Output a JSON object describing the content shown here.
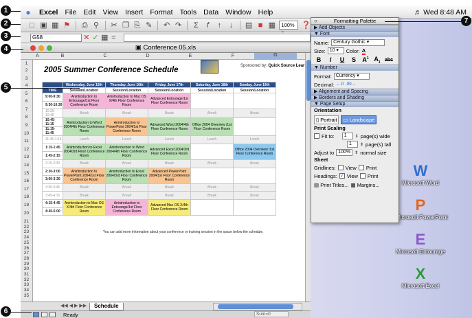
{
  "menubar": {
    "app": "Excel",
    "items": [
      "File",
      "Edit",
      "View",
      "Insert",
      "Format",
      "Tools",
      "Data",
      "Window",
      "Help"
    ],
    "clock": "Wed 8:48 AM"
  },
  "toolbar": {
    "zoom": "100%"
  },
  "formula_bar": {
    "name_box": "G58",
    "fx_value": ""
  },
  "window": {
    "title": "Conference 05.xls"
  },
  "sheet": {
    "title": "2005 Summer Conference Schedule",
    "sponsor_label": "Sponsored by:",
    "sponsor_name": "Quick Source Lear",
    "columns": [
      "A",
      "B",
      "C",
      "D",
      "E",
      "F",
      "G"
    ],
    "rows": [
      "1",
      "2",
      "3",
      "4",
      "5",
      "6",
      "7",
      "8",
      "9",
      "10",
      "11",
      "12",
      "13",
      "14",
      "15",
      "16",
      "17",
      "18",
      "19",
      "20",
      "21",
      "22",
      "23",
      "24",
      "25",
      "26",
      "27",
      "28",
      "29",
      "30",
      "31",
      "32",
      "33",
      "34",
      "35"
    ],
    "days": [
      "Wednesday, June 15th",
      "Thursday, June 16th",
      "Friday, June 17th",
      "Saturday, June 18th",
      "Sunday, June 19th"
    ],
    "time_header": "TIME",
    "session_header": "Session/Location",
    "schedule": [
      {
        "time": "9:00-9:30",
        "cells": [
          {
            "t": "Anintroduction to Entourage/1st Floor Conference Room",
            "c": "pink",
            "span": 2
          },
          {
            "t": "Anintroduction to Mac OS X/4th Floor Conference Room",
            "c": "pink",
            "span": 2
          },
          {
            "t": "Advanced Entourage/1st Floor Conference Room",
            "c": "pink",
            "span": 2
          },
          {
            "t": "",
            "c": "",
            "span": 2
          },
          {
            "t": "",
            "c": "",
            "span": 2
          }
        ]
      },
      {
        "time": "9:30-10:30"
      },
      {
        "time": "10:30-10:45",
        "cells": [
          {
            "t": "Break",
            "c": "brk"
          },
          {
            "t": "Break",
            "c": "brk"
          },
          {
            "t": "Break",
            "c": "brk"
          },
          {
            "t": "Break",
            "c": "brk"
          },
          {
            "t": "Break",
            "c": "brk"
          }
        ]
      },
      {
        "time": "10:45-11:15",
        "cells": [
          {
            "t": "Anintroduction to Word 2004/4th Floor Conference Room",
            "c": "green",
            "span": 2
          },
          {
            "t": "Anintroduction to PowerPoint 2004/1st Floor Conference Room",
            "c": "orange",
            "span": 2
          },
          {
            "t": "Advanced Word 2004/4th Floor Conference Room",
            "c": "green",
            "span": 2
          },
          {
            "t": "Office 2004 Overview /1st Floor Conference Room",
            "c": "green",
            "span": 2
          },
          {
            "t": "",
            "c": "",
            "span": 2
          }
        ]
      },
      {
        "time": "11:15-11:45"
      },
      {
        "time": "11:45-1:15",
        "cells": [
          {
            "t": "Lunch",
            "c": "brk"
          },
          {
            "t": "Lunch",
            "c": "brk"
          },
          {
            "t": "Lunch",
            "c": "brk"
          },
          {
            "t": "Lunch",
            "c": "brk"
          },
          {
            "t": "Lunch",
            "c": "brk"
          }
        ]
      },
      {
        "time": "1:15-1:45",
        "cells": [
          {
            "t": "Anintroduction to Excel 2004/3rd Floor Conference Room",
            "c": "green",
            "span": 2
          },
          {
            "t": "Anintroduction to Word 2004/4th Floor Conference Room",
            "c": "green",
            "span": 2
          },
          {
            "t": "Advanced Excel 2004/3rd Floor Conference Room",
            "c": "green",
            "span": 2
          },
          {
            "t": "",
            "c": "",
            "span": 2
          },
          {
            "t": "Office 2004 Overview /1st Floor Conference Room",
            "c": "blue",
            "span": 2
          }
        ]
      },
      {
        "time": "1:45-2:15"
      },
      {
        "time": "2:15-2:30",
        "cells": [
          {
            "t": "Break",
            "c": "brk"
          },
          {
            "t": "Break",
            "c": "brk"
          },
          {
            "t": "Break",
            "c": "brk"
          },
          {
            "t": "Break",
            "c": "brk"
          },
          {
            "t": "Break",
            "c": "brk"
          }
        ]
      },
      {
        "time": "2:30-3:00",
        "cells": [
          {
            "t": "Anintroduction to PowerPoint 2004/1st Floor Conference Room",
            "c": "orange",
            "span": 2
          },
          {
            "t": "Anintroduction to Excel 2004/3rd Floor Conference Room",
            "c": "green",
            "span": 2
          },
          {
            "t": "Advanced PowerPoint 2004/1st Floor Conference Room",
            "c": "orange",
            "span": 2
          },
          {
            "t": "",
            "c": "",
            "span": 2
          },
          {
            "t": "",
            "c": "",
            "span": 2
          }
        ]
      },
      {
        "time": "3:00-3:30"
      },
      {
        "time": "3:30-3:45",
        "cells": [
          {
            "t": "Break",
            "c": "brk"
          },
          {
            "t": "Break",
            "c": "brk"
          },
          {
            "t": "Break",
            "c": "brk"
          },
          {
            "t": "Break",
            "c": "brk"
          },
          {
            "t": "Break",
            "c": "brk"
          }
        ]
      },
      {
        "time": "3:45-4:15",
        "cells": [
          {
            "t": "Break",
            "c": "brk"
          },
          {
            "t": "Break",
            "c": "brk"
          },
          {
            "t": "Break",
            "c": "brk"
          },
          {
            "t": "Break",
            "c": "brk"
          },
          {
            "t": "Break",
            "c": "brk"
          }
        ]
      },
      {
        "time": "4:15-4:45",
        "cells": [
          {
            "t": "Anintroduction to Mac OS X/4th Floor Conference Room",
            "c": "yellow",
            "span": 2
          },
          {
            "t": "Anintroduction to Entourage/1st Floor Conference Room",
            "c": "pink",
            "span": 2
          },
          {
            "t": "Advanced Mac OS X/4th Floor Conference Room",
            "c": "yellow",
            "span": 2
          },
          {
            "t": "",
            "c": "",
            "span": 2
          },
          {
            "t": "",
            "c": "",
            "span": 2
          }
        ]
      },
      {
        "time": "4:45-5:00"
      }
    ],
    "note": "You can add more information about your conference or training session in the space below the schedule.",
    "tab": "Schedule"
  },
  "status": {
    "text": "Ready",
    "sum": "Sum=0"
  },
  "palette": {
    "title": "Formatting Palette",
    "sections": {
      "add_objects": "Add Objects",
      "font": "Font",
      "number": "Number",
      "alignment": "Alignment and Spacing",
      "borders": "Borders and Shading",
      "page_setup": "Page Setup"
    },
    "font": {
      "name_label": "Name:",
      "name_value": "Century Gothic",
      "size_label": "Size:",
      "size_value": "10",
      "color_label": "Color:"
    },
    "number": {
      "format_label": "Format:",
      "format_value": "Currency",
      "decimal_label": "Decimal:"
    },
    "page_setup": {
      "orientation_label": "Orientation",
      "portrait": "Portrait",
      "landscape": "Landscape",
      "print_scaling_label": "Print Scaling",
      "fit_to": "Fit to:",
      "wide_value": "1",
      "wide_label": "page(s) wide",
      "tall_value": "1",
      "tall_label": "page(s) tall",
      "adjust_label": "Adjust to",
      "adjust_value": "100%",
      "adjust_suffix": "normal size",
      "sheet_label": "Sheet",
      "gridlines_label": "Gridlines:",
      "headings_label": "Headings:",
      "view": "View",
      "print": "Print",
      "print_titles": "Print Titles...",
      "margins": "Margins..."
    }
  },
  "desktop_icons": [
    "Microsoft Word",
    "Microsoft PowerPoint",
    "Microsoft Entourage",
    "Microsoft Excel"
  ],
  "callouts": [
    "1",
    "2",
    "3",
    "4",
    "5",
    "6",
    "7"
  ],
  "colors": {
    "header_blue": "#2c4f8c",
    "accent": "#5e8fd8"
  }
}
